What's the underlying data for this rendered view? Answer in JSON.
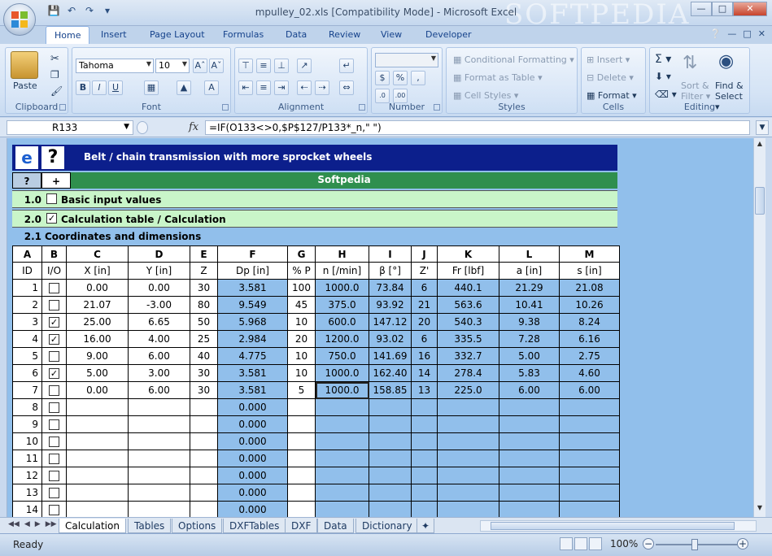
{
  "window": {
    "title": "mpulley_02.xls  [Compatibility Mode] - Microsoft Excel",
    "watermark": "SOFTPEDIA"
  },
  "ribbon_tabs": [
    "Home",
    "Insert",
    "Page Layout",
    "Formulas",
    "Data",
    "Review",
    "View",
    "Developer"
  ],
  "ribbon": {
    "clipboard": {
      "label": "Clipboard",
      "paste": "Paste"
    },
    "font": {
      "label": "Font",
      "family": "Tahoma",
      "size": "10"
    },
    "alignment": {
      "label": "Alignment"
    },
    "number": {
      "label": "Number"
    },
    "styles": {
      "label": "Styles",
      "conditional": "Conditional Formatting",
      "format_table": "Format as Table",
      "cell_styles": "Cell Styles"
    },
    "cells": {
      "label": "Cells",
      "insert": "Insert",
      "delete": "Delete",
      "format": "Format"
    },
    "editing": {
      "label": "Editing",
      "sort": "Sort &",
      "filter": "Filter",
      "find": "Find &",
      "select": "Select"
    }
  },
  "formula_bar": {
    "name_box": "R133",
    "fx": "fx",
    "formula": "=IF(O133<>0,$P$127/P133*_n,\" \")"
  },
  "sheet": {
    "banner_title": "Belt / chain transmission with more sprocket wheels",
    "help_q": "?",
    "plus": "+",
    "brand": "Softpedia",
    "sections": [
      {
        "num": "1.0",
        "title": "Basic input values",
        "checked": false
      },
      {
        "num": "2.0",
        "title": "Calculation table / Calculation",
        "checked": true
      }
    ],
    "subsection": {
      "num": "2.1",
      "title": "Coordinates and dimensions"
    },
    "column_letters": [
      "A",
      "B",
      "C",
      "D",
      "E",
      "F",
      "G",
      "H",
      "I",
      "J",
      "K",
      "L",
      "M"
    ],
    "column_units": [
      "ID",
      "I/O",
      "X [in]",
      "Y [in]",
      "Z",
      "Dp [in]",
      "% P",
      "n [/min]",
      "β [°]",
      "Z'",
      "Fr [lbf]",
      "a [in]",
      "s [in]"
    ],
    "rows": [
      {
        "id": "1",
        "io": false,
        "x": "0.00",
        "y": "0.00",
        "z": "30",
        "dp": "3.581",
        "p": "100",
        "n": "1000.0",
        "beta": "73.84",
        "zp": "6",
        "fr": "440.1",
        "a": "21.29",
        "s": "21.08"
      },
      {
        "id": "2",
        "io": false,
        "x": "21.07",
        "y": "-3.00",
        "z": "80",
        "dp": "9.549",
        "p": "45",
        "n": "375.0",
        "beta": "93.92",
        "zp": "21",
        "fr": "563.6",
        "a": "10.41",
        "s": "10.26"
      },
      {
        "id": "3",
        "io": true,
        "x": "25.00",
        "y": "6.65",
        "z": "50",
        "dp": "5.968",
        "p": "10",
        "n": "600.0",
        "beta": "147.12",
        "zp": "20",
        "fr": "540.3",
        "a": "9.38",
        "s": "8.24"
      },
      {
        "id": "4",
        "io": true,
        "x": "16.00",
        "y": "4.00",
        "z": "25",
        "dp": "2.984",
        "p": "20",
        "n": "1200.0",
        "beta": "93.02",
        "zp": "6",
        "fr": "335.5",
        "a": "7.28",
        "s": "6.16"
      },
      {
        "id": "5",
        "io": false,
        "x": "9.00",
        "y": "6.00",
        "z": "40",
        "dp": "4.775",
        "p": "10",
        "n": "750.0",
        "beta": "141.69",
        "zp": "16",
        "fr": "332.7",
        "a": "5.00",
        "s": "2.75"
      },
      {
        "id": "6",
        "io": true,
        "x": "5.00",
        "y": "3.00",
        "z": "30",
        "dp": "3.581",
        "p": "10",
        "n": "1000.0",
        "beta": "162.40",
        "zp": "14",
        "fr": "278.4",
        "a": "5.83",
        "s": "4.60"
      },
      {
        "id": "7",
        "io": false,
        "x": "0.00",
        "y": "6.00",
        "z": "30",
        "dp": "3.581",
        "p": "5",
        "n": "1000.0",
        "beta": "158.85",
        "zp": "13",
        "fr": "225.0",
        "a": "6.00",
        "s": "6.00"
      },
      {
        "id": "8",
        "io": false,
        "x": "",
        "y": "",
        "z": "",
        "dp": "0.000",
        "p": "",
        "n": "",
        "beta": "",
        "zp": "",
        "fr": "",
        "a": "",
        "s": ""
      },
      {
        "id": "9",
        "io": false,
        "x": "",
        "y": "",
        "z": "",
        "dp": "0.000",
        "p": "",
        "n": "",
        "beta": "",
        "zp": "",
        "fr": "",
        "a": "",
        "s": ""
      },
      {
        "id": "10",
        "io": false,
        "x": "",
        "y": "",
        "z": "",
        "dp": "0.000",
        "p": "",
        "n": "",
        "beta": "",
        "zp": "",
        "fr": "",
        "a": "",
        "s": ""
      },
      {
        "id": "11",
        "io": false,
        "x": "",
        "y": "",
        "z": "",
        "dp": "0.000",
        "p": "",
        "n": "",
        "beta": "",
        "zp": "",
        "fr": "",
        "a": "",
        "s": ""
      },
      {
        "id": "12",
        "io": false,
        "x": "",
        "y": "",
        "z": "",
        "dp": "0.000",
        "p": "",
        "n": "",
        "beta": "",
        "zp": "",
        "fr": "",
        "a": "",
        "s": ""
      },
      {
        "id": "13",
        "io": false,
        "x": "",
        "y": "",
        "z": "",
        "dp": "0.000",
        "p": "",
        "n": "",
        "beta": "",
        "zp": "",
        "fr": "",
        "a": "",
        "s": ""
      },
      {
        "id": "14",
        "io": false,
        "x": "",
        "y": "",
        "z": "",
        "dp": "0.000",
        "p": "",
        "n": "",
        "beta": "",
        "zp": "",
        "fr": "",
        "a": "",
        "s": ""
      }
    ]
  },
  "sheet_tabs": [
    "Calculation",
    "Tables",
    "Options",
    "DXFTables",
    "DXF",
    "Data",
    "Dictionary"
  ],
  "status": {
    "ready": "Ready",
    "zoom": "100%"
  }
}
